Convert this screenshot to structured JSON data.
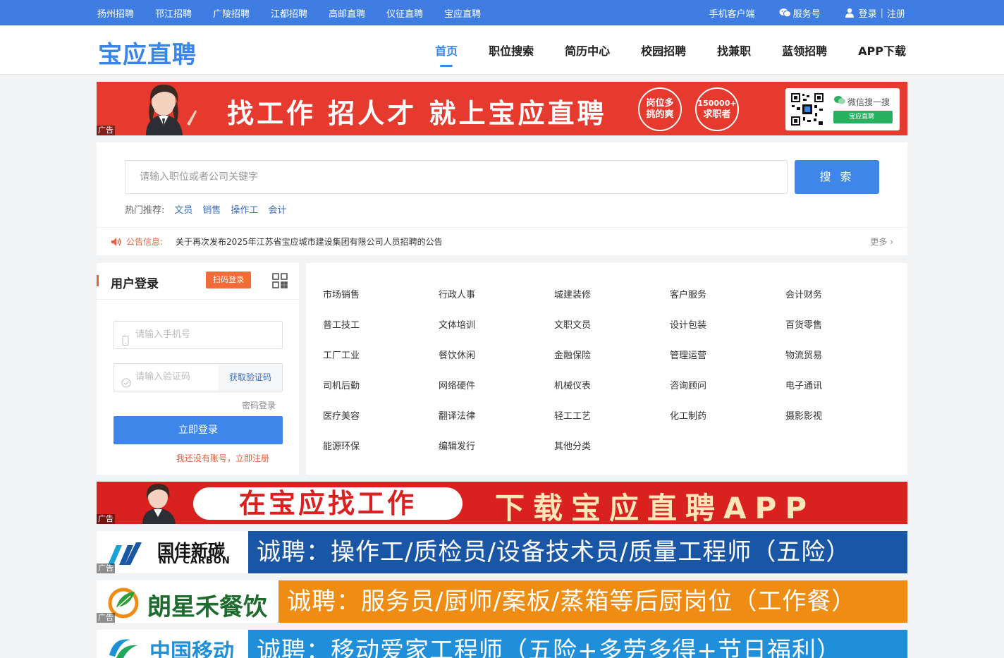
{
  "topbar": {
    "cities": [
      "扬州招聘",
      "邗江招聘",
      "广陵招聘",
      "江都招聘",
      "高邮直聘",
      "仪征直聘",
      "宝应直聘"
    ],
    "mobile": "手机客户端",
    "service": "服务号",
    "login": "登录",
    "register": "注册"
  },
  "header": {
    "logo": "宝应直聘",
    "nav": [
      "首页",
      "职位搜索",
      "简历中心",
      "校园招聘",
      "找兼职",
      "蓝领招聘",
      "APP下载"
    ]
  },
  "ad_tag": "广告",
  "banner1": {
    "slogan": "找工作 招人才 就上宝应直聘",
    "circle1": [
      "岗位多",
      "挑的爽"
    ],
    "circle2": [
      "150000+",
      "求职者"
    ],
    "wechat": "微信搜一搜",
    "search_tag": "宝应直聘"
  },
  "search": {
    "placeholder": "请输入职位或者公司关键字",
    "button": "搜 索",
    "hot_label": "热门推荐:",
    "hot": [
      "文员",
      "销售",
      "操作工",
      "会计"
    ]
  },
  "notice": {
    "label": "公告信息:",
    "text": "关于再次发布2025年江苏省宝应城市建设集团有限公司人员招聘的公告",
    "more": "更多"
  },
  "login": {
    "title": "用户登录",
    "qr_tag": "扫码登录",
    "phone_placeholder": "请输入手机号",
    "code_placeholder": "请输入验证码",
    "get_code": "获取验证码",
    "pwd_login": "密码登录",
    "submit": "立即登录",
    "register": "我还没有账号，立即注册"
  },
  "categories": [
    "市场销售",
    "行政人事",
    "城建装修",
    "客户服务",
    "会计财务",
    "普工技工",
    "文体培训",
    "文职文员",
    "设计包装",
    "百货零售",
    "工厂工业",
    "餐饮休闲",
    "金融保险",
    "管理运营",
    "物流贸易",
    "司机后勤",
    "网络硬件",
    "机械仪表",
    "咨询顾问",
    "电子通讯",
    "医疗美容",
    "翻译法律",
    "轻工工艺",
    "化工制药",
    "摄影影视",
    "能源环保",
    "编辑发行",
    "其他分类"
  ],
  "banner2": {
    "left": "在宝应找工作",
    "right": "下载宝应直聘APP"
  },
  "banner3": {
    "company": "国佳新碳",
    "company_en": "NIV CARBON",
    "text": "诚聘：操作工/质检员/设备技术员/质量工程师（五险）",
    "color": "#1a56a6"
  },
  "banner4": {
    "company": "朗星禾餐饮",
    "text": "诚聘：服务员/厨师/案板/蒸箱等后厨岗位（工作餐）",
    "color": "#ef8c14"
  },
  "banner5": {
    "company": "中国移动",
    "text": "诚聘：移动爱家工程师（五险+多劳多得+节日福利）",
    "color": "#1f8fd9"
  }
}
